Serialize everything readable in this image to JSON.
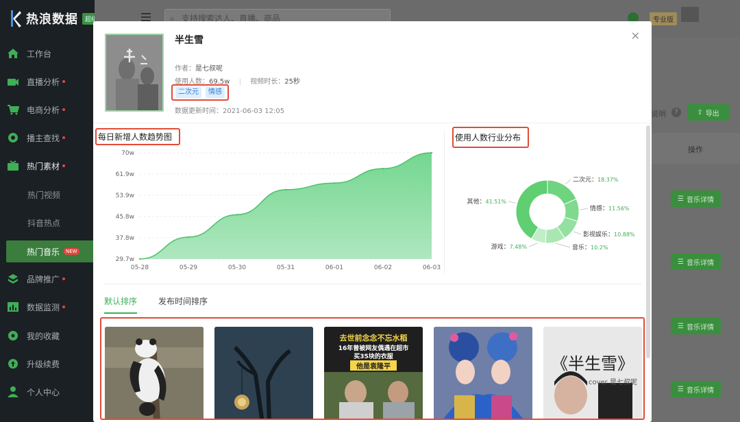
{
  "app": {
    "name": "热浪数据",
    "badge": "超级版"
  },
  "topbar": {
    "search_placeholder": "支持搜索达人、直播、商品",
    "edition": "专业版"
  },
  "sidebar": {
    "items": [
      {
        "label": "工作台",
        "icon": "home-icon"
      },
      {
        "label": "直播分析",
        "icon": "live-icon",
        "dot": true
      },
      {
        "label": "电商分析",
        "icon": "cart-icon",
        "dot": true
      },
      {
        "label": "播主查找",
        "icon": "gear-search-icon",
        "dot": true
      },
      {
        "label": "热门素材",
        "icon": "media-icon",
        "dot": true
      },
      {
        "label": "热门视频"
      },
      {
        "label": "抖音热点"
      },
      {
        "label": "热门音乐",
        "tag": "NEW"
      },
      {
        "label": "品牌推广",
        "icon": "brand-icon",
        "dot": true
      },
      {
        "label": "数据监测",
        "icon": "monitor-icon",
        "dot": true
      },
      {
        "label": "我的收藏",
        "icon": "favorite-icon"
      },
      {
        "label": "升级续费",
        "icon": "upgrade-icon"
      },
      {
        "label": "个人中心",
        "icon": "user-icon"
      }
    ]
  },
  "background": {
    "explain": "说明",
    "export": "导出",
    "col_action": "操作",
    "row_button": "音乐详情"
  },
  "modal": {
    "title": "半生雪",
    "author_label": "作者：",
    "author": "是七叔呢",
    "users_label": "使用人数：",
    "users": "69.5w",
    "duration_label": "视频时长：",
    "duration": "25秒",
    "tags": [
      "二次元",
      "情感"
    ],
    "updated_label": "数据更新时间：",
    "updated": "2021-06-03 12:05",
    "trend_title": "每日新增人数趋势图",
    "dist_title": "使用人数行业分布",
    "tab_default": "默认排序",
    "tab_time": "发布时间排序",
    "video_texts": {
      "v3_line1": "去世前念念不忘水稻",
      "v3_line2": "16年曾被网友偶遇在超市",
      "v3_line3": "买35块的衣服",
      "v3_line4": "他是袁隆平",
      "v5_title": "《半生雪》",
      "v5_sub": "cover 是七叔呢"
    }
  },
  "chart_data": [
    {
      "type": "area",
      "title": "每日新增人数趋势图",
      "x": [
        "05-28",
        "05-29",
        "05-30",
        "05-31",
        "06-01",
        "06-02",
        "06-03"
      ],
      "y_ticks": [
        "70w",
        "61.9w",
        "53.9w",
        "45.8w",
        "37.8w",
        "29.7w"
      ],
      "ylim": [
        29.7,
        70
      ],
      "values": [
        29.7,
        38.0,
        46.5,
        56.0,
        58.5,
        64.0,
        70.0
      ],
      "color": "#6dd48a"
    },
    {
      "type": "pie",
      "title": "使用人数行业分布",
      "slices": [
        {
          "label": "二次元",
          "value": 18.37,
          "text": "18.37%",
          "color": "#6ed47f"
        },
        {
          "label": "情感",
          "value": 11.56,
          "text": "11.56%",
          "color": "#7fd98e"
        },
        {
          "label": "影视娱乐",
          "value": 10.88,
          "text": "10.88%",
          "color": "#94e0a0"
        },
        {
          "label": "音乐",
          "value": 10.2,
          "text": "10.2%",
          "color": "#a9e7b2"
        },
        {
          "label": "游戏",
          "value": 7.48,
          "text": "7.48%",
          "color": "#c1eec7"
        },
        {
          "label": "其他",
          "value": 41.51,
          "text": "41.51%",
          "color": "#5fcf72"
        }
      ]
    }
  ]
}
